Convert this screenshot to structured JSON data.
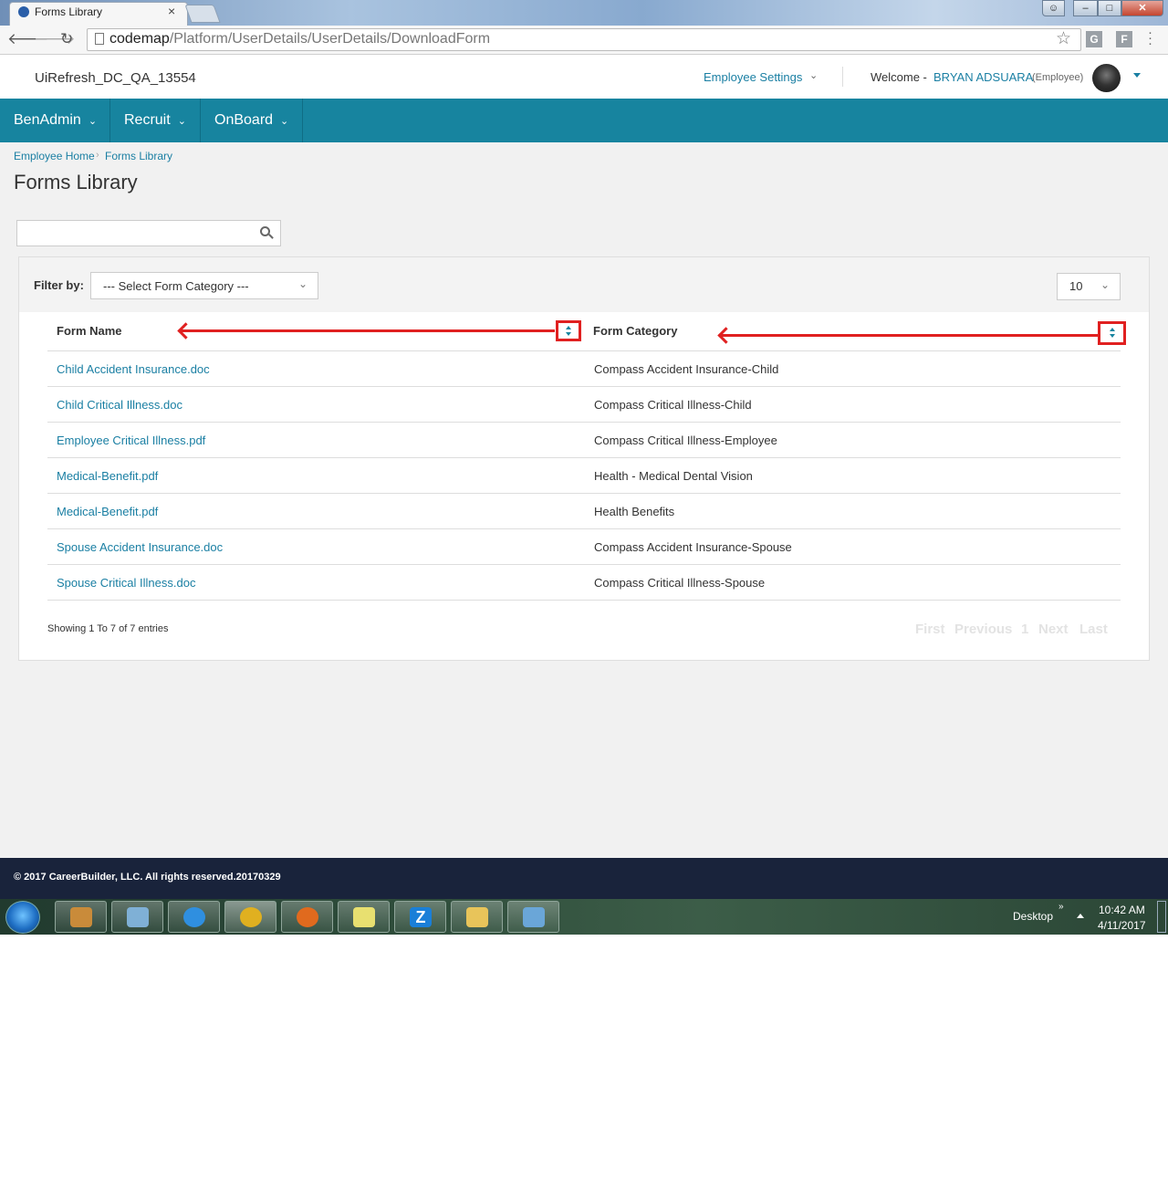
{
  "browser": {
    "tab_title": "Forms Library",
    "tab_close": "×",
    "url_host": "codemap",
    "url_path": "/Platform/UserDetails/UserDetails/DownloadForm",
    "window_buttons": {
      "user": "☺",
      "minimize": "–",
      "maximize": "□",
      "close": "✕"
    },
    "extensions": [
      "G",
      "F"
    ]
  },
  "header": {
    "env_name": "UiRefresh_DC_QA_13554",
    "employee_settings": "Employee Settings",
    "welcome": "Welcome -",
    "user_name": "BRYAN ADSUARA",
    "user_role": "(Employee)"
  },
  "nav": {
    "items": [
      {
        "label": "BenAdmin"
      },
      {
        "label": "Recruit"
      },
      {
        "label": "OnBoard"
      }
    ]
  },
  "breadcrumb": {
    "home": "Employee Home",
    "separator": "›",
    "current": "Forms Library"
  },
  "page_title": "Forms Library",
  "search": {
    "placeholder": "",
    "value": ""
  },
  "filter": {
    "label": "Filter by:",
    "category_selected": "--- Select Form Category ---",
    "page_size": "10"
  },
  "table": {
    "headers": [
      "Form Name",
      "Form Category"
    ],
    "rows": [
      {
        "name": "Child Accident Insurance.doc",
        "category": "Compass Accident Insurance-Child"
      },
      {
        "name": "Child Critical Illness.doc",
        "category": "Compass Critical Illness-Child"
      },
      {
        "name": "Employee Critical Illness.pdf",
        "category": "Compass Critical Illness-Employee"
      },
      {
        "name": "Medical-Benefit.pdf",
        "category": "Health - Medical Dental Vision"
      },
      {
        "name": "Medical-Benefit.pdf",
        "category": "Health Benefits"
      },
      {
        "name": "Spouse Accident Insurance.doc",
        "category": "Compass Accident Insurance-Spouse"
      },
      {
        "name": "Spouse Critical Illness.doc",
        "category": "Compass Critical Illness-Spouse"
      }
    ]
  },
  "pagination": {
    "showing": "Showing 1 To 7 of 7 entries",
    "first": "First",
    "previous": "Previous",
    "page": "1",
    "next": "Next",
    "last": "Last"
  },
  "footer": {
    "copyright": "© 2017 CareerBuilder, LLC. All rights reserved.20170329"
  },
  "taskbar": {
    "desktop_label": "Desktop",
    "desktop_chevron": "»",
    "time": "10:42 AM",
    "date": "4/11/2017",
    "pinned": [
      {
        "name": "paint",
        "color": "#c98b3a"
      },
      {
        "name": "notepad",
        "color": "#7fb0d6"
      },
      {
        "name": "internet-explorer",
        "color": "#2f8fe0"
      },
      {
        "name": "chrome",
        "color": "#e0b020"
      },
      {
        "name": "firefox",
        "color": "#e06a1e"
      },
      {
        "name": "sticky-notes",
        "color": "#e8e070"
      },
      {
        "name": "zoom",
        "color": "#1a7fd8",
        "glyph": "Z"
      },
      {
        "name": "file-explorer",
        "color": "#e8c45a"
      },
      {
        "name": "image-viewer",
        "color": "#6aa6d8"
      }
    ]
  }
}
